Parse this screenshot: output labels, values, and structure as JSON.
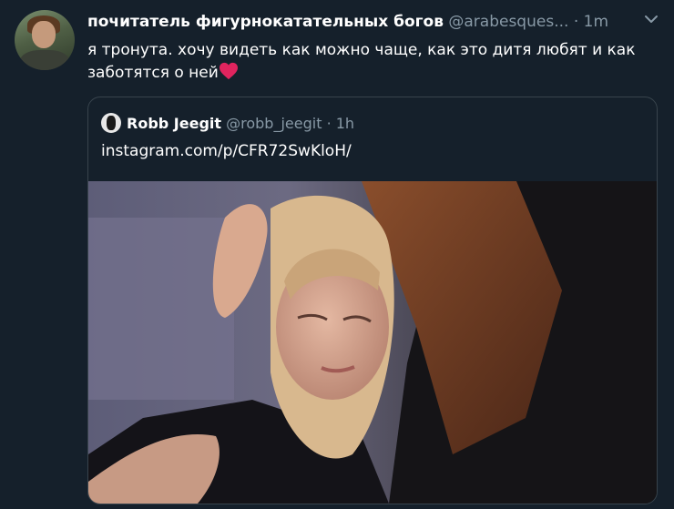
{
  "tweet": {
    "display_name": "почитатель фигурнокатательных богов",
    "handle": "@arabesques...",
    "separator": "·",
    "time": "1m",
    "text": "я тронута. хочу видеть как можно чаще, как это дитя любят и как заботятся о ней"
  },
  "quoted_tweet": {
    "display_name": "Robb Jeegit",
    "handle": "@robb_jeegit",
    "separator": "·",
    "time": "1h",
    "text": "instagram.com/p/CFR72SwKloH/"
  },
  "icons": {
    "more": "chevron-down-icon",
    "emoji": "red-heart-icon"
  },
  "colors": {
    "background": "#15202b",
    "secondary_text": "#8899a6",
    "border": "#38444d",
    "heart": "#e0245e"
  }
}
